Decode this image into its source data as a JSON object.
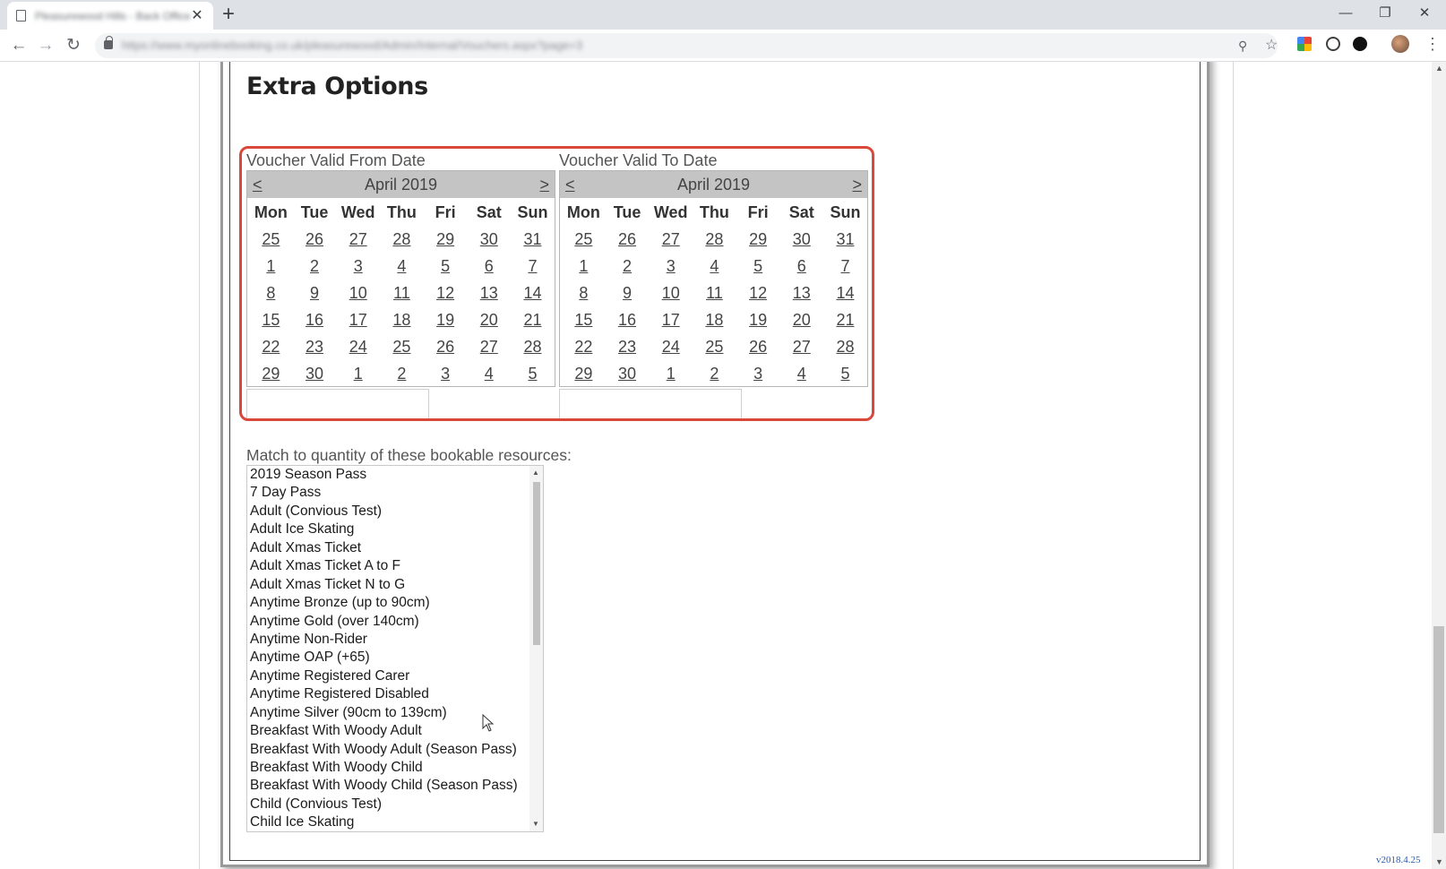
{
  "browser": {
    "tab_title": "Pleasurewood Hills - Back Office",
    "tab_close": "✕",
    "new_tab": "+",
    "url": "https://www.myonlinebooking.co.uk/pleasurewood/Admin/Internal/Vouchers.aspx?page=3",
    "minimize": "—",
    "restore": "❐",
    "close": "✕",
    "back": "←",
    "forward": "→",
    "reload": "↻",
    "zoom": "⚲",
    "star": "☆",
    "menu": "⋮"
  },
  "page": {
    "heading": "Extra Options",
    "valid_from": {
      "label": "Voucher Valid From Date",
      "month": "April 2019",
      "prev": "<",
      "next": ">",
      "input_value": ""
    },
    "valid_to": {
      "label": "Voucher Valid To Date",
      "month": "April 2019",
      "prev": "<",
      "next": ">",
      "input_value": ""
    },
    "weekdays": [
      "Mon",
      "Tue",
      "Wed",
      "Thu",
      "Fri",
      "Sat",
      "Sun"
    ],
    "weeks": [
      [
        "25",
        "26",
        "27",
        "28",
        "29",
        "30",
        "31"
      ],
      [
        "1",
        "2",
        "3",
        "4",
        "5",
        "6",
        "7"
      ],
      [
        "8",
        "9",
        "10",
        "11",
        "12",
        "13",
        "14"
      ],
      [
        "15",
        "16",
        "17",
        "18",
        "19",
        "20",
        "21"
      ],
      [
        "22",
        "23",
        "24",
        "25",
        "26",
        "27",
        "28"
      ],
      [
        "29",
        "30",
        "1",
        "2",
        "3",
        "4",
        "5"
      ]
    ],
    "match_label": "Match to quantity of these bookable resources:",
    "resources": [
      "2019 Season Pass",
      "7 Day Pass",
      "Adult (Convious Test)",
      "Adult Ice Skating",
      "Adult Xmas Ticket",
      "Adult Xmas Ticket A to F",
      "Adult Xmas Ticket N to G",
      "Anytime Bronze (up to 90cm)",
      "Anytime Gold (over 140cm)",
      "Anytime Non-Rider",
      "Anytime OAP (+65)",
      "Anytime Registered Carer",
      "Anytime Registered Disabled",
      "Anytime Silver (90cm to 139cm)",
      "Breakfast With Woody Adult",
      "Breakfast With Woody Adult (Season Pass)",
      "Breakfast With Woody Child",
      "Breakfast With Woody Child (Season Pass)",
      "Child (Convious Test)",
      "Child Ice Skating"
    ],
    "version": "v2018.4.25"
  }
}
